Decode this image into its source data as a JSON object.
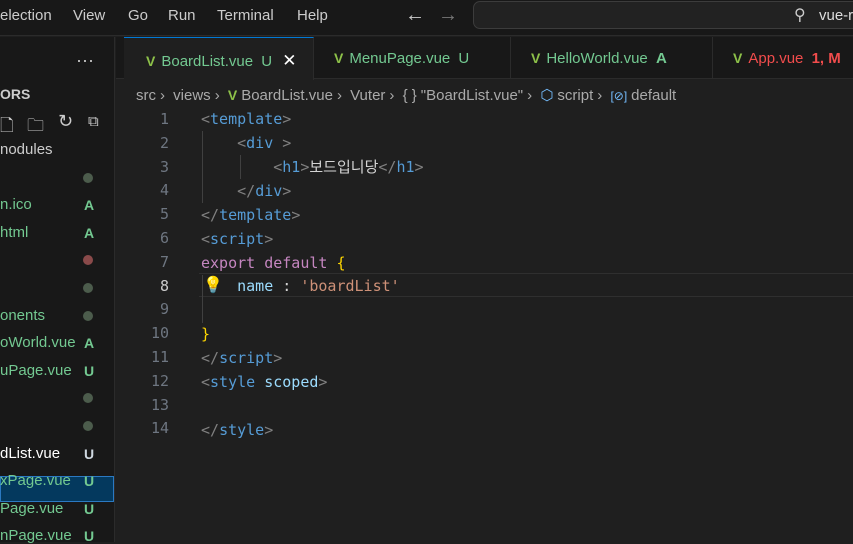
{
  "menu": [
    "election",
    "View",
    "Go",
    "Run",
    "Terminal",
    "Help"
  ],
  "search": {
    "text": "vue-r"
  },
  "sidebar": {
    "more": "···",
    "section": "ORS",
    "items": [
      {
        "label": "nodules",
        "status": "",
        "color": "#ccc"
      },
      {
        "label": "",
        "status": "dot",
        "color": "#ccc"
      },
      {
        "label": "n.ico",
        "status": "A",
        "color": "#73c991"
      },
      {
        "label": "html",
        "status": "A",
        "color": "#73c991"
      },
      {
        "label": "",
        "status": "dot-red",
        "color": "#ccc"
      },
      {
        "label": "",
        "status": "dot",
        "color": "#ccc"
      },
      {
        "label": "onents",
        "status": "dot",
        "color": "#73c991"
      },
      {
        "label": "oWorld.vue",
        "status": "A",
        "color": "#73c991"
      },
      {
        "label": "uPage.vue",
        "status": "U",
        "color": "#73c991"
      },
      {
        "label": "",
        "status": "dot",
        "color": "#ccc"
      },
      {
        "label": "",
        "status": "dot",
        "color": "#ccc"
      },
      {
        "label": "dList.vue",
        "status": "U",
        "color": "#ffffff"
      },
      {
        "label": "xPage.vue",
        "status": "U",
        "color": "#73c991"
      },
      {
        "label": "Page.vue",
        "status": "U",
        "color": "#73c991"
      },
      {
        "label": "nPage.vue",
        "status": "U",
        "color": "#73c991"
      }
    ]
  },
  "tabs": [
    {
      "label": "BoardList.vue",
      "status": "U",
      "color": "#73c991",
      "active": true
    },
    {
      "label": "MenuPage.vue",
      "status": "U",
      "color": "#73c991"
    },
    {
      "label": "HelloWorld.vue",
      "status": "A",
      "color": "#73c991"
    },
    {
      "label": "App.vue",
      "status": "1, M",
      "color": "#f14c4c"
    }
  ],
  "breadcrumb": [
    "src",
    "views",
    "BoardList.vue",
    "Vuter",
    "\"BoardList.vue\"",
    "script",
    "default"
  ],
  "code": {
    "lines": [
      "1",
      "2",
      "3",
      "4",
      "5",
      "6",
      "7",
      "8",
      "9",
      "10",
      "11",
      "12",
      "13",
      "14"
    ],
    "l1": "template",
    "l2": "div",
    "l3a": "h1",
    "l3b": "보드입니당",
    "l3c": "h1",
    "l4": "div",
    "l5": "template",
    "l6": "script",
    "l7a": "export",
    "l7b": "default",
    "l8a": "name",
    "l8b": "'boardList'",
    "l11": "script",
    "l12a": "style",
    "l12b": "scoped",
    "l14": "style"
  },
  "colors": {
    "accent": "#0078d4",
    "vue": "#8dc149"
  }
}
